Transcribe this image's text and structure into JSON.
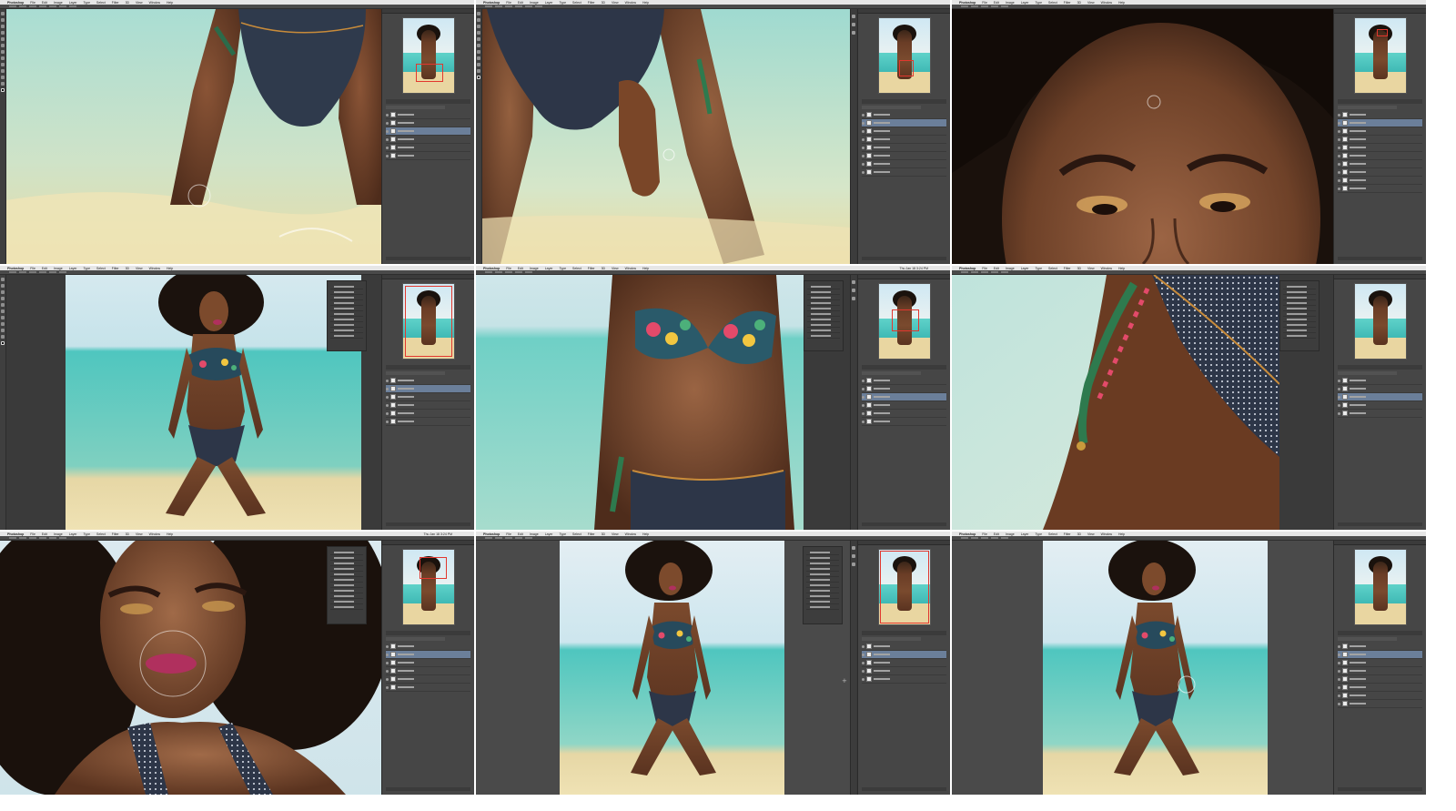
{
  "window": {
    "layout": "3x3 grid of Photoshop retouching screenshots",
    "background": "#ffffff"
  },
  "menu": {
    "items": [
      "Photoshop",
      "File",
      "Edit",
      "Image",
      "Layer",
      "Type",
      "Select",
      "Filter",
      "3D",
      "View",
      "Window",
      "Help"
    ],
    "clock": "Thu Jan 18 3:24 PM"
  },
  "colors": {
    "ui_dark": "#3a3a3a",
    "panel": "#464646",
    "selected_layer": "#6b7f9a",
    "navigator_box": "#e2372e",
    "sea": "#4fc6bf",
    "sky": "#cfe8f3",
    "sand": "#e9d6a1"
  },
  "tiles": [
    {
      "scene": "knees-in-water",
      "icons": [
        "navigator-icon",
        "layers-icon"
      ]
    },
    {
      "scene": "hip-hand-close",
      "icons": [
        "navigator-icon",
        "layers-icon"
      ]
    },
    {
      "scene": "face-eyes-close",
      "icons": [
        "navigator-icon",
        "layers-icon"
      ]
    },
    {
      "scene": "full-body-left",
      "icons": [
        "navigator-icon",
        "layers-icon"
      ]
    },
    {
      "scene": "torso-bikini",
      "icons": [
        "navigator-icon",
        "layers-icon"
      ]
    },
    {
      "scene": "tie-detail",
      "icons": [
        "navigator-icon",
        "layers-icon"
      ]
    },
    {
      "scene": "face-lips",
      "icons": [
        "navigator-icon",
        "layers-icon"
      ]
    },
    {
      "scene": "full-body-center",
      "icons": [
        "navigator-icon",
        "layers-icon"
      ]
    },
    {
      "scene": "full-body-center-brush",
      "icons": [
        "navigator-icon",
        "layers-icon"
      ]
    }
  ]
}
